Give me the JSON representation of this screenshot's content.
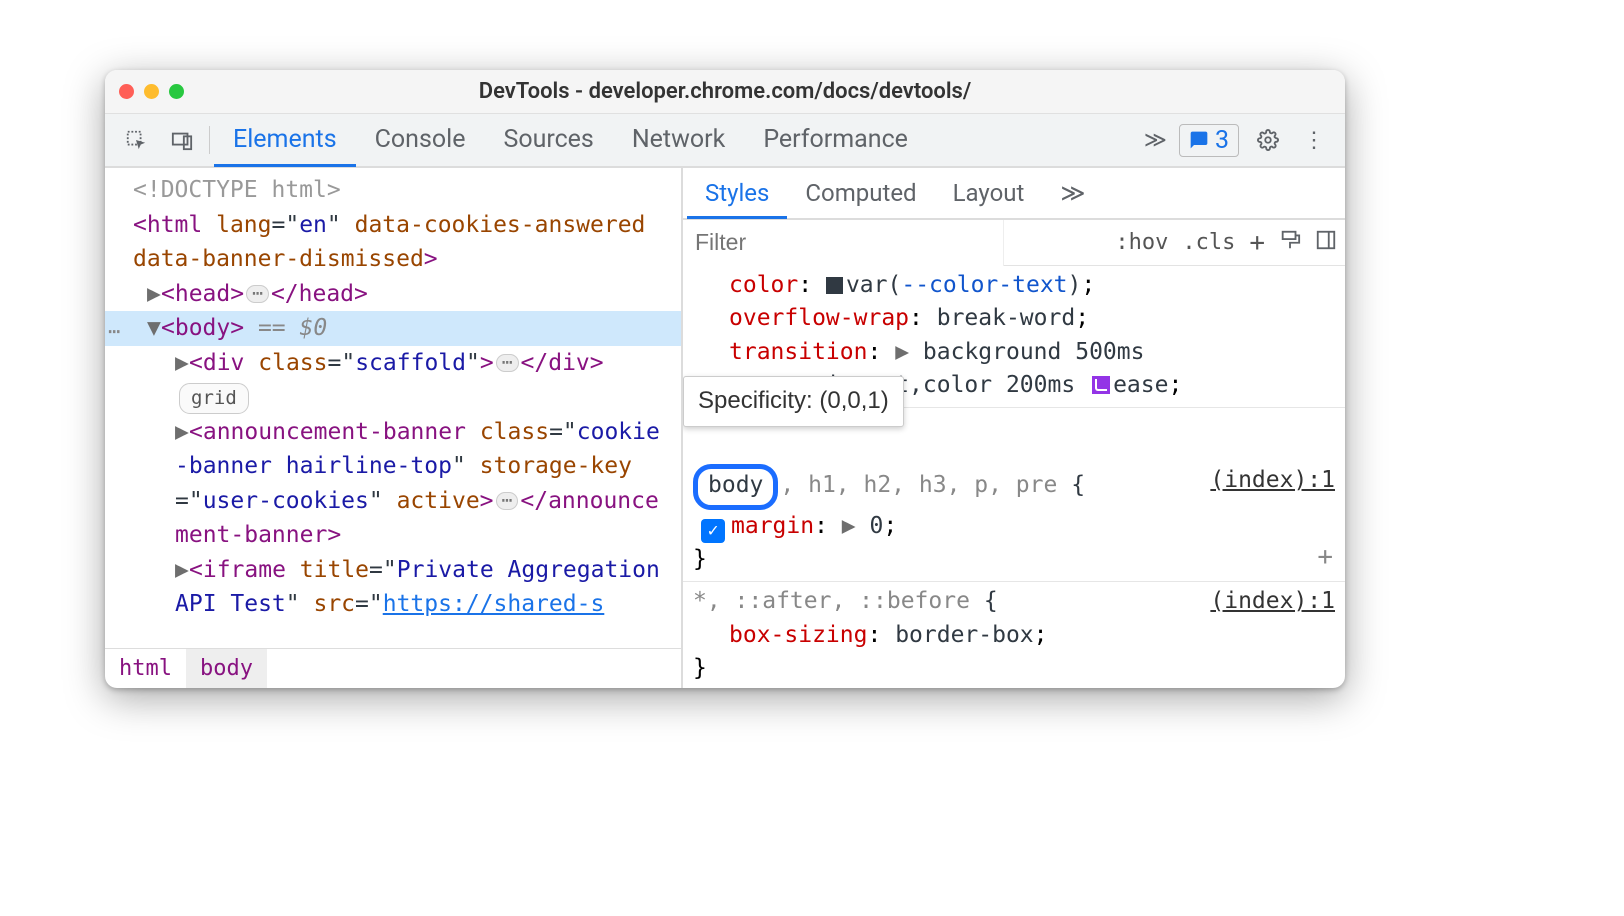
{
  "window": {
    "title": "DevTools - developer.chrome.com/docs/devtools/"
  },
  "main_tabs": [
    "Elements",
    "Console",
    "Sources",
    "Network",
    "Performance"
  ],
  "toolbar": {
    "issue_count": "3"
  },
  "dom": {
    "doctype": "<!DOCTYPE html>",
    "html_open": "<html lang=\"en\" data-cookies-answered data-banner-dismissed>",
    "head_open": "<head>",
    "head_close": "</head>",
    "body_open": "<body>",
    "selref": " == $0",
    "div_open": "<div class=\"scaffold\">",
    "div_close": "</div>",
    "grid_badge": "grid",
    "ann_open_a": "<announcement-banner class=\"cooki",
    "ann_open_b": "e-banner hairline-top\" storage-",
    "ann_open_c": "key=\"user-cookies\" active>",
    "ann_close": "</announcement-banner>",
    "iframe_open_a": "<iframe title=\"Private Aggregatio",
    "iframe_open_b": "n API Test\" src=\"",
    "iframe_src": "https://shared-s"
  },
  "breadcrumbs": [
    "html",
    "body"
  ],
  "side_tabs": [
    "Styles",
    "Computed",
    "Layout"
  ],
  "styles_toolbar": {
    "filter_ph": "Filter",
    "hov": ":hov",
    "cls": ".cls"
  },
  "tooltip": {
    "text": "Specificity: (0,0,1)"
  },
  "rule1": {
    "p_color": {
      "name": "color",
      "var": "--color-text"
    },
    "p_over": {
      "name": "overflow-wrap",
      "val": "break-word"
    },
    "p_trans": {
      "name": "transition",
      "val_a": "background 500ms",
      "val_b": "-in-out,color 200ms",
      "val_c": "ease"
    }
  },
  "rule2": {
    "sel_main": "body",
    "sel_rest": "h1, h2, h3, p, pre",
    "brace_open": "{",
    "src": "(index):1",
    "p_margin": {
      "name": "margin",
      "val": "0"
    },
    "brace_close": "}"
  },
  "rule3": {
    "sel": "*, ::after, ::before",
    "brace_open": "{",
    "src": "(index):1",
    "p_box": {
      "name": "box-sizing",
      "val": "border-box"
    },
    "brace_close": "}"
  }
}
